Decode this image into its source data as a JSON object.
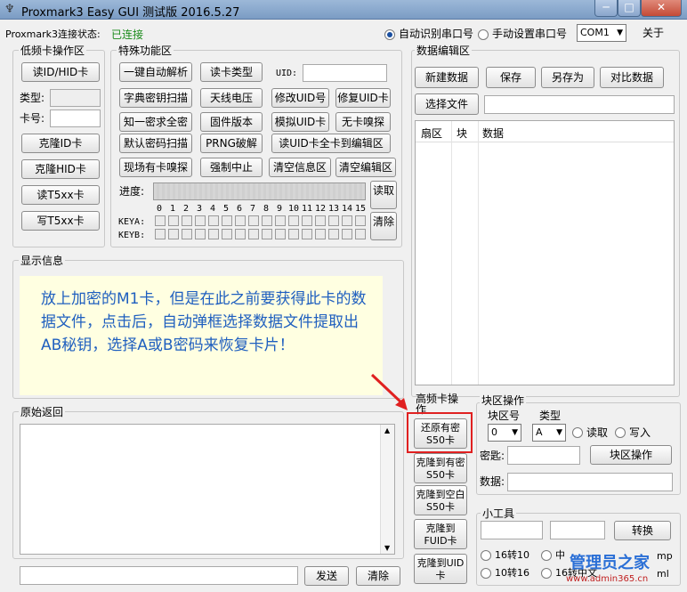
{
  "window": {
    "title": "Proxmark3 Easy GUI 测试版 2016.5.27"
  },
  "conn": {
    "status_label": "Proxmark3连接状态:",
    "status_value": "已连接",
    "auto_label": "自动识别串口号",
    "manual_label": "手动设置串口号",
    "port_value": "COM1",
    "about": "关于"
  },
  "lf": {
    "title": "低频卡操作区",
    "read_id_hid": "读ID/HID卡",
    "type_label": "类型:",
    "card_label": "卡号:",
    "clone_id": "克隆ID卡",
    "clone_hid": "克隆HID卡",
    "read_t5": "读T5xx卡",
    "write_t5": "写T5xx卡"
  },
  "special": {
    "title": "特殊功能区",
    "buttons": [
      "一键自动解析",
      "读卡类型",
      "字典密钥扫描",
      "天线电压",
      "修改UID号",
      "修复UID卡",
      "知一密求全密",
      "固件版本",
      "模拟UID卡",
      "无卡嗅探",
      "默认密码扫描",
      "PRNG破解",
      "读UID卡全卡到编辑区",
      "现场有卡嗅探",
      "强制中止",
      "清空信息区",
      "清空编辑区"
    ],
    "uid_label": "UID:",
    "progress_label": "进度:",
    "read_btn": "读取",
    "clear_btn": "清除",
    "sector_nums": [
      "0",
      "1",
      "2",
      "3",
      "4",
      "5",
      "6",
      "7",
      "8",
      "9",
      "10",
      "11",
      "12",
      "13",
      "14",
      "15"
    ],
    "keya": "KEYA:",
    "keyb": "KEYB:"
  },
  "display": {
    "title": "显示信息",
    "text": "放上加密的M1卡，但是在此之前要获得此卡的数据文件，点击后，自动弹框选择数据文件提取出AB秘钥，选择A或B密码来恢复卡片！"
  },
  "raw": {
    "title": "原始返回",
    "send_btn": "发送",
    "clear_btn": "清除"
  },
  "editor": {
    "title": "数据编辑区",
    "new_btn": "新建数据",
    "save_btn": "保存",
    "saveas_btn": "另存为",
    "compare_btn": "对比数据",
    "select_btn": "选择文件",
    "col_sector": "扇区",
    "col_block": "块",
    "col_data": "数据"
  },
  "hf": {
    "title": "高频卡操作",
    "restore_s50": "还原有密S50卡",
    "clone_pw_s50": "克隆到有密S50卡",
    "clone_empty_s50": "克隆到空白S50卡",
    "clone_fuid": "克隆到FUID卡",
    "clone_uid": "克隆到UID卡"
  },
  "block": {
    "title": "块区操作",
    "block_no_label": "块区号",
    "type_label": "类型",
    "block_no_value": "0",
    "type_value": "A",
    "read_label": "读取",
    "write_label": "写入",
    "key_label": "密匙:",
    "data_label": "数据:",
    "op_btn": "块区操作"
  },
  "tools": {
    "title": "小工具",
    "convert_btn": "转换",
    "hex2dec": "16转10",
    "dec2hex": "10转16",
    "cn": "中",
    "hex2cn": "16转中文",
    "tmp": "mp",
    "html": "ml"
  },
  "watermark": {
    "line1": "管理员之家",
    "line2": "www.admin365.cn"
  },
  "annotation": {
    "color": "#e02020"
  }
}
